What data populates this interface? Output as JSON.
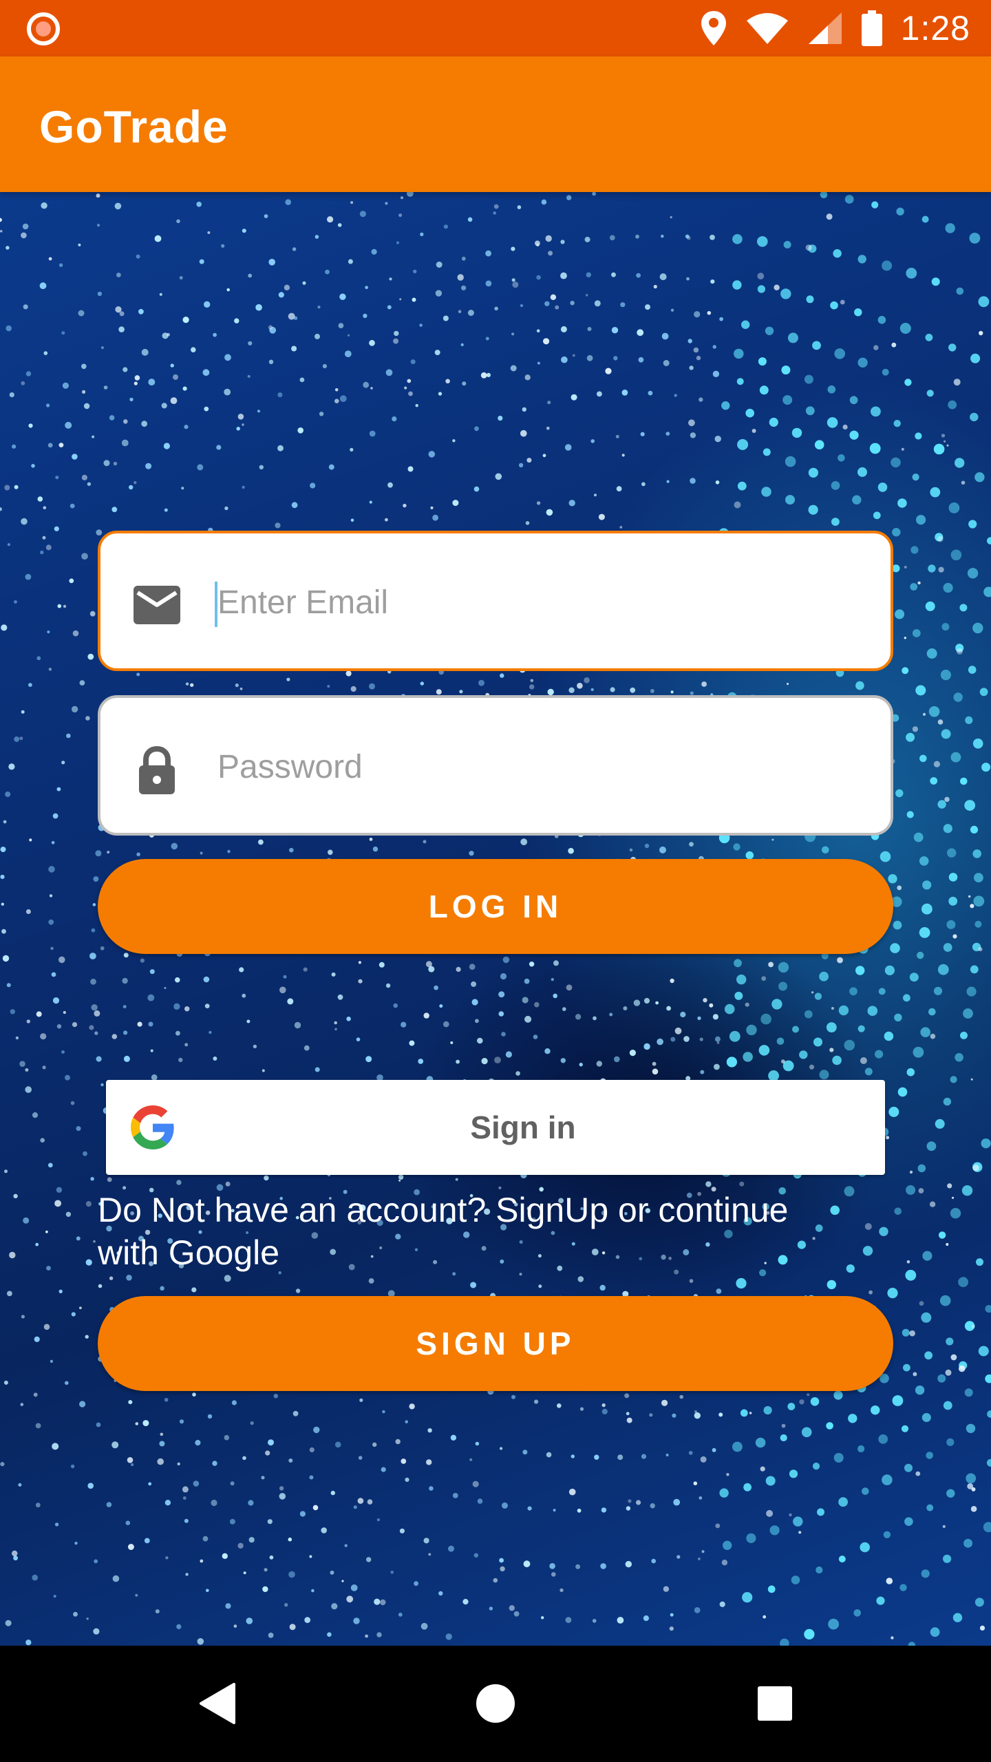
{
  "status_bar": {
    "time": "1:28",
    "icons": [
      "record-icon",
      "location-icon",
      "wifi-icon",
      "signal-icon",
      "battery-icon"
    ]
  },
  "app_bar": {
    "title": "GoTrade"
  },
  "login_form": {
    "email_placeholder": "Enter Email",
    "email_value": "",
    "password_placeholder": "Password",
    "password_value": "",
    "login_label": "LOG IN"
  },
  "google": {
    "sign_in_label": "Sign in"
  },
  "signup": {
    "hint": "Do Not have an account? SignUp or continue with Google",
    "signup_label": "SIGN UP"
  },
  "nav_bar": {
    "buttons": [
      "back-icon",
      "home-icon",
      "recents-icon"
    ]
  },
  "colors": {
    "status_bar": "#e65100",
    "app_bar": "#f57c00",
    "accent": "#f57c00",
    "field_border_focused": "#f57c00",
    "field_border": "#bdbdbd"
  }
}
